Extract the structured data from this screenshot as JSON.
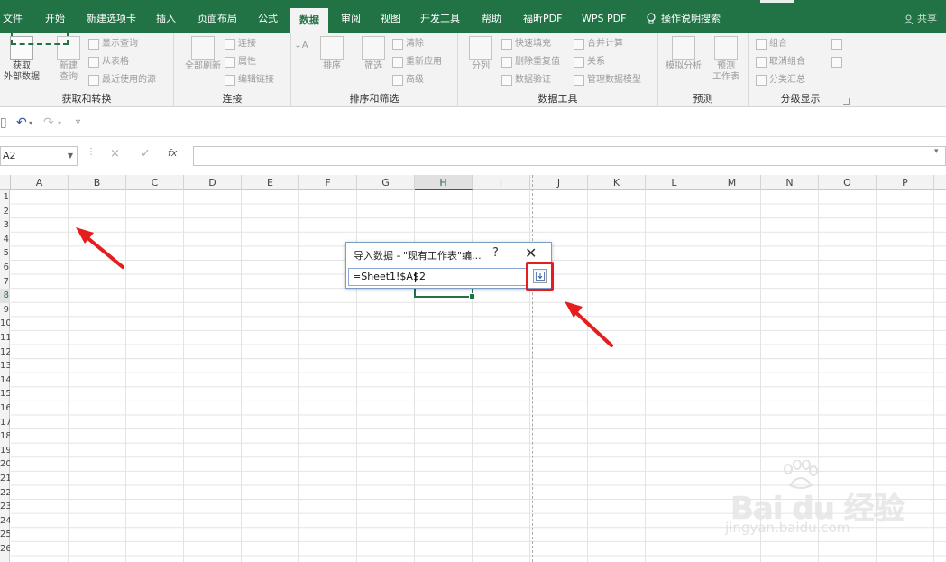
{
  "tabs": [
    "文件",
    "开始",
    "新建选项卡",
    "插入",
    "页面布局",
    "公式",
    "数据",
    "审阅",
    "视图",
    "开发工具",
    "帮助",
    "福昕PDF",
    "WPS PDF",
    "操作说明搜索"
  ],
  "share_label": "共享",
  "ribbon": {
    "groups": [
      {
        "label": "获取和转换",
        "big_buttons": [
          "获取\n外部数据",
          "新建\n查询"
        ],
        "small_buttons": [
          "显示查询",
          "从表格",
          "最近使用的源"
        ]
      },
      {
        "label": "连接",
        "big_buttons": [
          "全部刷新"
        ],
        "small_buttons": [
          "连接",
          "属性",
          "编辑链接"
        ]
      },
      {
        "label": "排序和筛选",
        "big_buttons": [
          "排序",
          "筛选"
        ],
        "small_buttons": [
          "清除",
          "重新应用",
          "高级"
        ]
      },
      {
        "label": "数据工具",
        "big_buttons": [
          "分列"
        ],
        "small_buttons": [
          "快速填充",
          "删除重复值",
          "数据验证",
          "合并计算",
          "关系",
          "管理数据模型"
        ]
      },
      {
        "label": "预测",
        "big_buttons": [
          "模拟分析",
          "预测\n工作表"
        ]
      },
      {
        "label": "分级显示",
        "small_buttons": [
          "组合",
          "取消组合",
          "分类汇总"
        ]
      }
    ]
  },
  "namebox_value": "A2",
  "formula_icons": [
    "×",
    "✓",
    "fx"
  ],
  "columns": [
    "A",
    "B",
    "C",
    "D",
    "E",
    "F",
    "G",
    "H",
    "I",
    "J",
    "K",
    "L",
    "M",
    "N",
    "O",
    "P"
  ],
  "selected_column": "H",
  "rows": [
    "1",
    "2",
    "3",
    "4",
    "5",
    "6",
    "7",
    "8",
    "9",
    "10",
    "11",
    "12",
    "13",
    "14",
    "15",
    "16",
    "17",
    "18",
    "19",
    "20",
    "21",
    "22",
    "23",
    "24",
    "25",
    "26"
  ],
  "dialog": {
    "title": "导入数据 - \"现有工作表\"编...",
    "help": "?",
    "close": "✕",
    "reference": "=Sheet1!$A$2"
  },
  "watermark": {
    "text": "Bai du 经验",
    "sub": "jingyan.baidu.com"
  },
  "colors": {
    "accent": "#217346",
    "annotation": "#e41e1e"
  }
}
